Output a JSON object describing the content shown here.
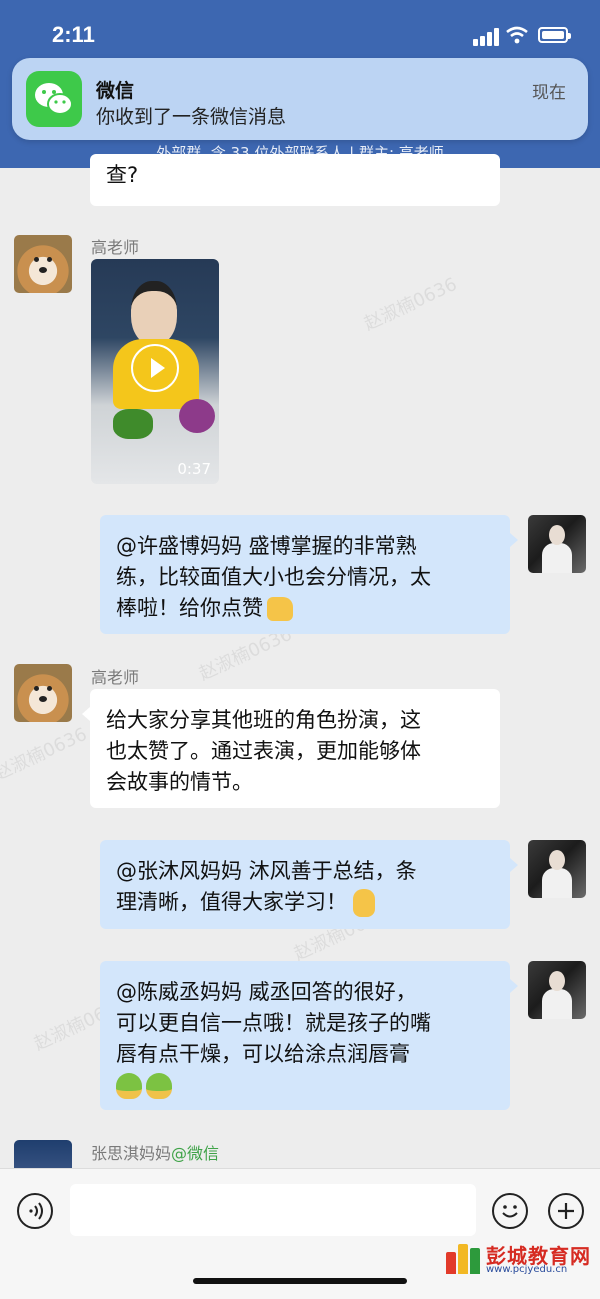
{
  "status": {
    "time": "2:11"
  },
  "notification": {
    "app": "微信",
    "message": "你收到了一条微信消息",
    "time": "现在"
  },
  "group_info": "外部群, 含 33 位外部联系人 | 群主: 高老师",
  "watermark": "赵淑楠0636",
  "messages": [
    {
      "text": "查?"
    },
    {
      "sender": "高老师",
      "video_duration": "0:37"
    },
    {
      "text": "@许盛博妈妈 盛博掌握的非常熟\n练，比较面值大小也会分情况，太\n棒啦！给你点赞"
    },
    {
      "sender": "高老师",
      "text": "给大家分享其他班的角色扮演，这\n也太赞了。通过表演，更加能够体\n会故事的情节。"
    },
    {
      "text": "@张沐风妈妈 沐风善于总结，条\n理清晰，值得大家学习！"
    },
    {
      "text": "@陈威丞妈妈 威丞回答的很好，\n可以更自信一点哦！就是孩子的嘴\n唇有点干燥，可以给涂点润唇膏"
    },
    {
      "sender": "张思淇妈妈",
      "sender_tag": "@微信"
    }
  ],
  "logo": {
    "title": "彭城教育网",
    "url": "www.pcjyedu.cn"
  },
  "colors": {
    "header": "#3d67b1",
    "bubble_self": "#d3e6fb",
    "bubble_other": "#ffffff",
    "wechat_green": "#3ec94a"
  }
}
